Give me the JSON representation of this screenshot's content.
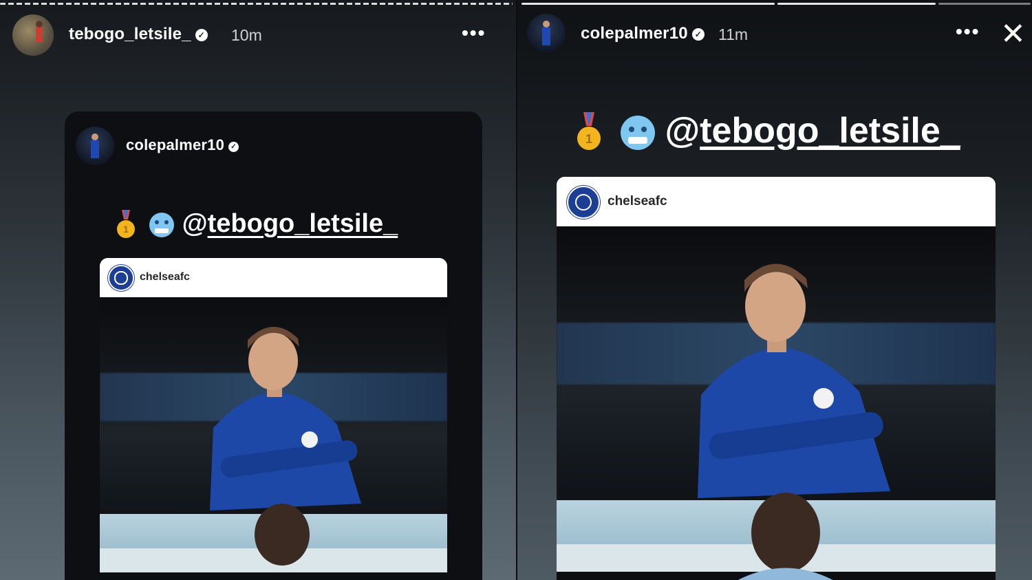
{
  "left_story": {
    "username": "tebogo_letsile_",
    "time": "10m",
    "more_label": "•••",
    "shared_story": {
      "username": "colepalmer10",
      "mention_prefix": "@",
      "mention": "tebogo_letsile_",
      "post_account": "chelseafc"
    }
  },
  "right_story": {
    "username": "colepalmer10",
    "time": "11m",
    "more_label": "•••",
    "close_label": "✕",
    "mention_prefix": "@",
    "mention": "tebogo_letsile_",
    "post_account": "chelseafc"
  },
  "emojis": [
    "gold-medal",
    "cold-face"
  ],
  "colors": {
    "chelsea_blue": "#1c3f95",
    "medal_gold": "#f2b51e",
    "cold_face_blue": "#7fc7f0"
  }
}
